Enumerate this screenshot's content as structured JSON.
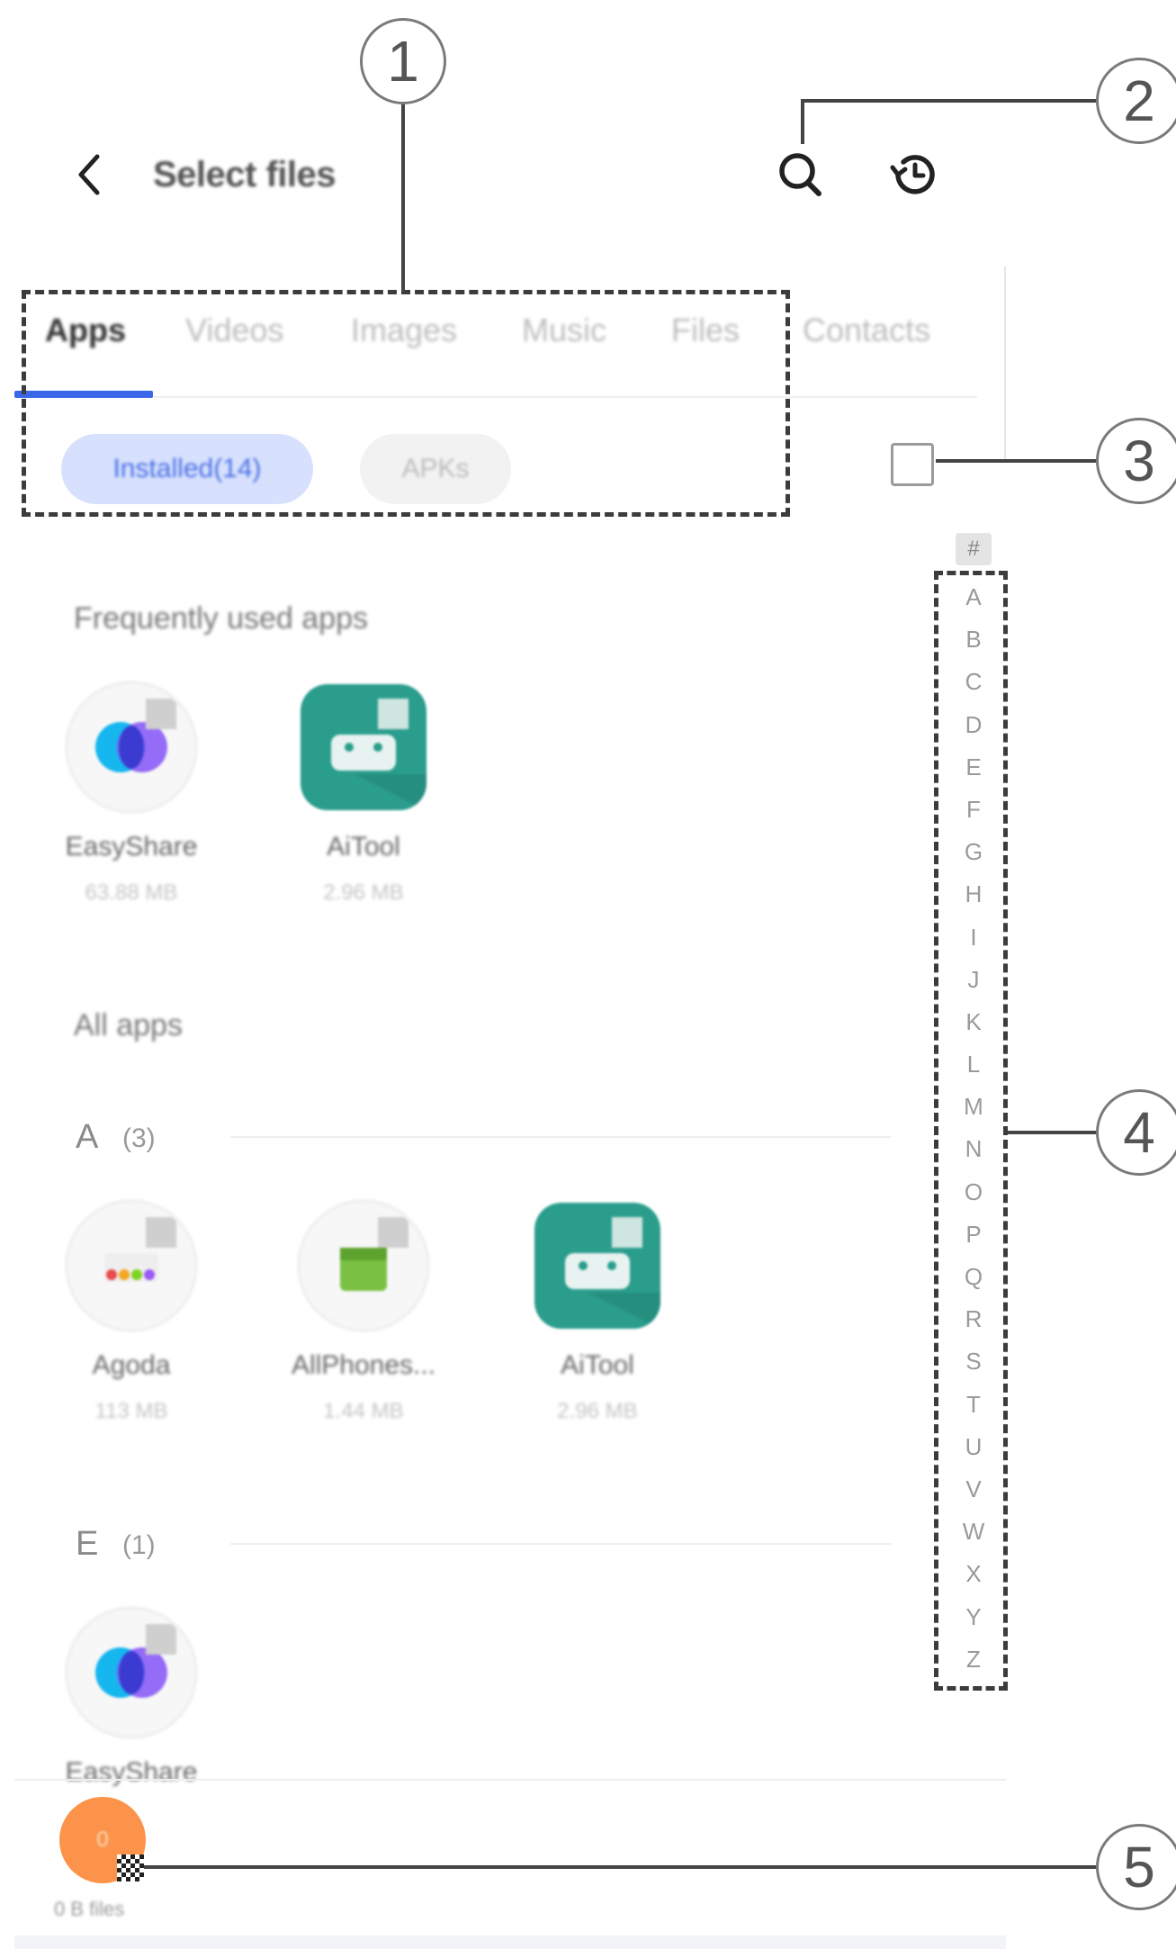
{
  "header": {
    "title": "Select files",
    "back_icon": "chevron-left-icon",
    "search_icon": "search-icon",
    "history_icon": "history-icon"
  },
  "tabs": [
    {
      "label": "Apps",
      "active": true
    },
    {
      "label": "Videos",
      "active": false
    },
    {
      "label": "Images",
      "active": false
    },
    {
      "label": "Music",
      "active": false
    },
    {
      "label": "Files",
      "active": false
    },
    {
      "label": "Contacts",
      "active": false
    }
  ],
  "filters": {
    "installed": "Installed(14)",
    "apks": "APKs"
  },
  "frequent": {
    "title": "Frequently used apps",
    "apps": [
      {
        "name": "EasyShare",
        "size": "63.88 MB"
      },
      {
        "name": "AiTool",
        "size": "2.96 MB"
      }
    ]
  },
  "all_apps": {
    "title": "All apps",
    "groups": [
      {
        "letter": "A",
        "count": "(3)",
        "apps": [
          {
            "name": "Agoda",
            "size": "113 MB"
          },
          {
            "name": "AllPhones...",
            "size": "1.44 MB"
          },
          {
            "name": "AiTool",
            "size": "2.96 MB"
          }
        ]
      },
      {
        "letter": "E",
        "count": "(1)",
        "apps": [
          {
            "name": "EasyShare",
            "size": ""
          }
        ]
      }
    ]
  },
  "index": {
    "hash": "#",
    "letters": [
      "A",
      "B",
      "C",
      "D",
      "E",
      "F",
      "G",
      "H",
      "I",
      "J",
      "K",
      "L",
      "M",
      "N",
      "O",
      "P",
      "Q",
      "R",
      "S",
      "T",
      "U",
      "V",
      "W",
      "X",
      "Y",
      "Z"
    ]
  },
  "bottom": {
    "selected_count": "0",
    "selected_size": "0 B files"
  },
  "callouts": [
    "1",
    "2",
    "3",
    "4",
    "5"
  ],
  "colors": {
    "accent": "#3a66e8",
    "chip_active_bg": "#d7e1fd",
    "selection_orange": "#fb944a",
    "android_green": "#2a9d8c"
  }
}
